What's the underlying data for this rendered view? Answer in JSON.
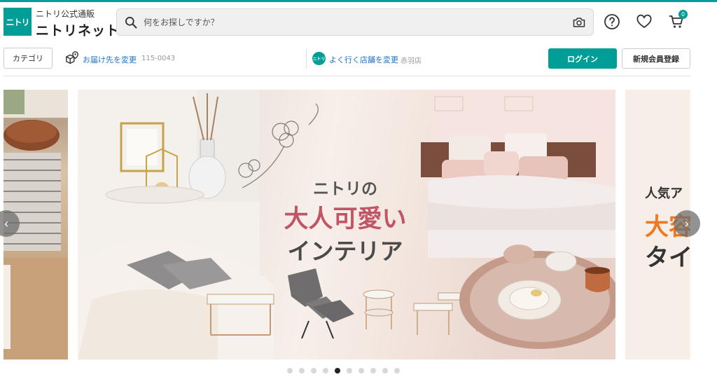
{
  "brand": {
    "logo_text": "ニトリ",
    "subtitle": "ニトリ公式通販",
    "name": "ニトリネット"
  },
  "search": {
    "placeholder": "何をお探しですか？",
    "value": ""
  },
  "header_icons": [
    "search-icon",
    "camera-icon",
    "help-icon",
    "heart-icon",
    "cart-icon"
  ],
  "cart": {
    "count": "0"
  },
  "nav": {
    "category_label": "カテゴリ",
    "delivery_link": "お届け先を変更",
    "postal_code": "115-0043",
    "store_logo_text": "ニトリ",
    "store_link": "よく行く店舗を変更",
    "store_name": "赤羽店",
    "login_label": "ログイン",
    "register_label": "新規会員登録"
  },
  "carousel": {
    "main_slide": {
      "line1": "ニトリの",
      "line2": "大人可愛い",
      "line3": "インテリア"
    },
    "next_slide": {
      "line1": "人気ア",
      "line2": "大容",
      "line3": "タイ"
    },
    "dot_count": 10,
    "active_index": 4,
    "prev_label": "‹",
    "next_label": "›"
  },
  "colors": {
    "accent": "#009e96",
    "link": "#1a73c9",
    "headline_pink": "#c15465",
    "headline_orange": "#f0781e"
  }
}
